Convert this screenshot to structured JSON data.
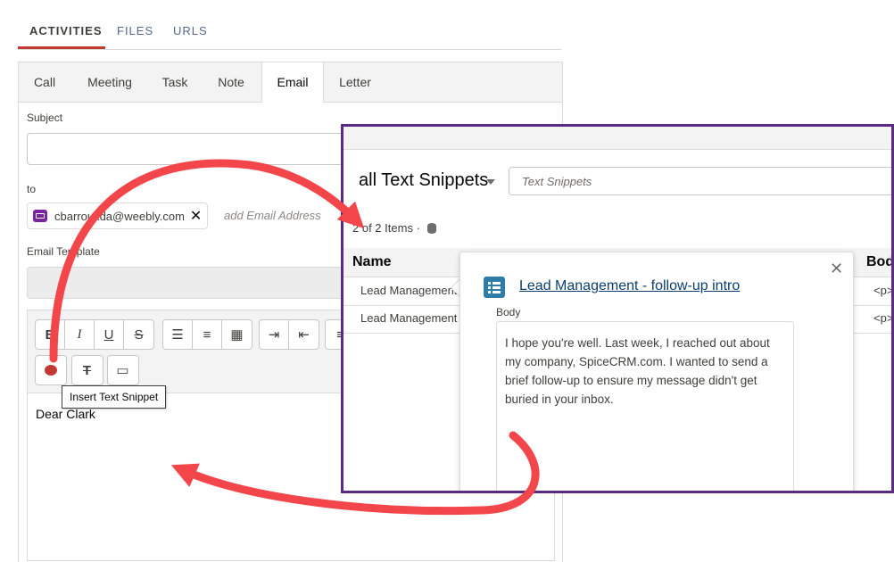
{
  "top_tabs": [
    "ACTIVITIES",
    "FILES",
    "URLS"
  ],
  "activity_tabs": [
    "Call",
    "Meeting",
    "Task",
    "Note",
    "Email",
    "Letter"
  ],
  "active_activity_tab": "Email",
  "form": {
    "subject_label": "Subject",
    "to_label": "to",
    "recipient": "cbarrouxda@weebly.com",
    "add_email_placeholder": "add Email Address",
    "template_label": "Email Template",
    "body_text": "Dear Clark"
  },
  "toolbar": {
    "tooltip": "Insert Text Snippet",
    "buttons_row1": [
      "bold",
      "italic",
      "underline",
      "strikethrough",
      "bullet-list",
      "numbered-list",
      "table",
      "indent",
      "outdent",
      "align"
    ],
    "buttons_row2": [
      "insert-snippet",
      "clear-format",
      "insert-template"
    ]
  },
  "snippets": {
    "title": "all Text Snippets",
    "search_placeholder": "Text Snippets",
    "count": "2 of 2",
    "items_label": "Items",
    "col_name": "Name",
    "col_body": "Body",
    "rows": [
      {
        "name": "Lead Management - follow-up intro",
        "body": "<p>"
      },
      {
        "name": "Lead Management",
        "body": "<p>"
      }
    ]
  },
  "popover": {
    "title": "Lead Management - follow-up intro",
    "body_label": "Body",
    "body_text": "I hope you're well. Last week, I reached out about my company, SpiceCRM.com. I wanted to send a brief follow-up to ensure my message didn't get buried in your inbox."
  },
  "colors": {
    "active_tab_underline": "#c23934",
    "overlay_border": "#5b2a86",
    "arrow": "#f2464b",
    "link": "#0b3e70",
    "snippet_icon": "#2d7da8"
  }
}
